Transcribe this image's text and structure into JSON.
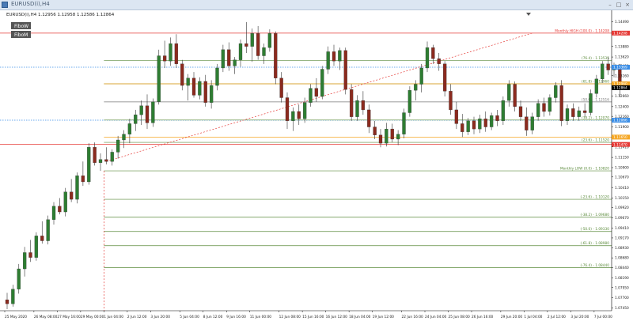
{
  "window": {
    "title": "EURUSD(i),H4",
    "minimize_glyph": "–",
    "maximize_glyph": "□",
    "close_glyph": "×"
  },
  "chart_info": "EURUSD(i),H4  1.12956 1.12958 1.12586 1.12864",
  "indicator_labels": [
    "FiboW",
    "FiboM"
  ],
  "current_price": {
    "value": 1.12864,
    "label": "1.12864",
    "color": "#000000"
  },
  "colors": {
    "bull": "#2e7d32",
    "bear": "#8b2a1e",
    "fib_green": "#5a8a3a",
    "monthly_high": "#e53935",
    "orange": "#f5a623",
    "blue_dotted": "#3b8ee6",
    "trend": "#e53935"
  },
  "price_axis_labels": [
    "1.14490",
    "1.14185",
    "1.13880",
    "1.13620",
    "1.13400",
    "1.13160",
    "1.12900",
    "1.12660",
    "1.12400",
    "1.12160",
    "1.11900",
    "1.11670",
    "1.11410",
    "1.11150",
    "1.10900",
    "1.10670",
    "1.10410",
    "1.10150",
    "1.09920",
    "1.09670",
    "1.09410",
    "1.09170",
    "1.08930",
    "1.08680",
    "1.08440",
    "1.08190",
    "1.07950",
    "1.07700",
    "1.07450"
  ],
  "price_tags": [
    {
      "price": 1.14208,
      "label": "1.14208",
      "color": "#e53935"
    },
    {
      "price": 1.13369,
      "label": "1.13369",
      "color": "#3b8ee6"
    },
    {
      "price": 1.1296,
      "label": "1.12960",
      "color": "#f5a623"
    },
    {
      "price": 1.12066,
      "label": "1.12066",
      "color": "#3b8ee6"
    },
    {
      "price": 1.1165,
      "label": "1.11650",
      "color": "#f5a623"
    },
    {
      "price": 1.1147,
      "label": "1.11470",
      "color": "#e53935"
    }
  ],
  "level_lines": [
    {
      "price": 1.14208,
      "label": "Monthly HIGH (100.0) - 1.14208",
      "color": "#e53935",
      "style": "solid",
      "label_at": "right"
    },
    {
      "price": 1.13535,
      "label": "(76.4) - 1.13535",
      "color": "#5a8a3a",
      "style": "solid",
      "label_at": "right"
    },
    {
      "price": 1.13369,
      "label": "",
      "color": "#3b8ee6",
      "style": "dotted",
      "label_at": "right"
    },
    {
      "price": 1.1296,
      "label": "(61.8) - 1.12960",
      "color": "#5a8a3a",
      "style": "solid",
      "label_at": "right"
    },
    {
      "price": 1.1296,
      "label": "",
      "color": "#f5a623",
      "style": "solid",
      "label_at": "right"
    },
    {
      "price": 1.12516,
      "label": "(50.0) - 1.12516",
      "color": "#7a7a7a",
      "style": "solid",
      "label_at": "right"
    },
    {
      "price": 1.12066,
      "label": "",
      "color": "#3b8ee6",
      "style": "dotted",
      "label_at": "right"
    },
    {
      "price": 1.1207,
      "label": "(38.2) - 1.12070",
      "color": "#5a8a3a",
      "style": "solid",
      "label_at": "right"
    },
    {
      "price": 1.1165,
      "label": "",
      "color": "#f5a623",
      "style": "solid",
      "label_at": "right"
    },
    {
      "price": 1.1152,
      "label": "(23.6) - 1.11520",
      "color": "#5a8a3a",
      "style": "solid",
      "label_at": "right"
    },
    {
      "price": 1.1147,
      "label": "",
      "color": "#e53935",
      "style": "solid",
      "label_at": "right"
    },
    {
      "price": 1.1082,
      "label": "Monthly LOW (0.0) - 1.10820",
      "color": "#5a8a3a",
      "style": "solid",
      "label_at": "right"
    },
    {
      "price": 1.1012,
      "label": "(-23.6) - 1.10120",
      "color": "#5a8a3a",
      "style": "solid",
      "label_at": "right"
    },
    {
      "price": 1.0968,
      "label": "(-38.2) - 1.09680",
      "color": "#5a8a3a",
      "style": "solid",
      "label_at": "right"
    },
    {
      "price": 1.0933,
      "label": "(-50.0) - 1.09330",
      "color": "#5a8a3a",
      "style": "solid",
      "label_at": "right"
    },
    {
      "price": 1.0898,
      "label": "(-61.8) - 1.08980",
      "color": "#5a8a3a",
      "style": "solid",
      "label_at": "right"
    },
    {
      "price": 1.0844,
      "label": "(-76.4) - 1.08440",
      "color": "#5a8a3a",
      "style": "solid",
      "label_at": "right"
    }
  ],
  "trend_line": {
    "from": {
      "bar": 17,
      "price": 1.1105
    },
    "to": {
      "bar": 90,
      "price": 1.14208
    }
  },
  "vertical_marker_bar": 17,
  "time_labels": [
    {
      "bar": 0,
      "label": "25 May 2020"
    },
    {
      "bar": 5,
      "label": "26 May 08:00"
    },
    {
      "bar": 9,
      "label": "27 May 16:00"
    },
    {
      "bar": 13,
      "label": "29 May 00:00"
    },
    {
      "bar": 17,
      "label": "1 Jun 04:00"
    },
    {
      "bar": 21,
      "label": "2 Jun 12:00"
    },
    {
      "bar": 25,
      "label": "3 Jun 20:00"
    },
    {
      "bar": 30,
      "label": "5 Jun 04:00"
    },
    {
      "bar": 34,
      "label": "8 Jun 12:00"
    },
    {
      "bar": 38,
      "label": "9 Jun 16:00"
    },
    {
      "bar": 42,
      "label": "11 Jun 00:00"
    },
    {
      "bar": 47,
      "label": "12 Jun 08:00"
    },
    {
      "bar": 51,
      "label": "15 Jun 16:00"
    },
    {
      "bar": 55,
      "label": "16 Jun 12:00"
    },
    {
      "bar": 59,
      "label": "18 Jun 04:00"
    },
    {
      "bar": 63,
      "label": "19 Jun 12:00"
    },
    {
      "bar": 68,
      "label": "22 Jun 16:00"
    },
    {
      "bar": 72,
      "label": "24 Jun 04:00"
    },
    {
      "bar": 76,
      "label": "25 Jun 08:00"
    },
    {
      "bar": 80,
      "label": "26 Jun 16:00"
    },
    {
      "bar": 85,
      "label": "29 Jun 20:00"
    },
    {
      "bar": 89,
      "label": "1 Jul 04:00"
    },
    {
      "bar": 93,
      "label": "2 Jul 12:00"
    },
    {
      "bar": 97,
      "label": "3 Jul 20:00"
    },
    {
      "bar": 101,
      "label": "7 Jul 00:00"
    }
  ],
  "chart_data": {
    "type": "candlestick",
    "symbol": "EURUSD(i)",
    "timeframe": "H4",
    "ylim": [
      1.0738,
      1.1473
    ],
    "x_range": [
      0,
      104
    ],
    "grid": false,
    "series": [
      {
        "open": 1.0765,
        "high": 1.0782,
        "low": 1.0742,
        "close": 1.0755
      },
      {
        "open": 1.0755,
        "high": 1.0802,
        "low": 1.0748,
        "close": 1.0791
      },
      {
        "open": 1.0791,
        "high": 1.0853,
        "low": 1.078,
        "close": 1.0841
      },
      {
        "open": 1.0841,
        "high": 1.0895,
        "low": 1.0822,
        "close": 1.0881
      },
      {
        "open": 1.0881,
        "high": 1.0912,
        "low": 1.0858,
        "close": 1.0869
      },
      {
        "open": 1.0869,
        "high": 1.0931,
        "low": 1.0861,
        "close": 1.0922
      },
      {
        "open": 1.0922,
        "high": 1.0958,
        "low": 1.0903,
        "close": 1.091
      },
      {
        "open": 1.091,
        "high": 1.0972,
        "low": 1.0901,
        "close": 1.0962
      },
      {
        "open": 1.0962,
        "high": 1.1005,
        "low": 1.095,
        "close": 1.0995
      },
      {
        "open": 1.0995,
        "high": 1.1015,
        "low": 1.0975,
        "close": 1.0981
      },
      {
        "open": 1.0981,
        "high": 1.104,
        "low": 1.097,
        "close": 1.103
      },
      {
        "open": 1.103,
        "high": 1.1062,
        "low": 1.1005,
        "close": 1.1012
      },
      {
        "open": 1.1012,
        "high": 1.1078,
        "low": 1.1002,
        "close": 1.107
      },
      {
        "open": 1.107,
        "high": 1.1105,
        "low": 1.1045,
        "close": 1.1055
      },
      {
        "open": 1.1055,
        "high": 1.115,
        "low": 1.1048,
        "close": 1.114
      },
      {
        "open": 1.114,
        "high": 1.1152,
        "low": 1.1095,
        "close": 1.1102
      },
      {
        "open": 1.1102,
        "high": 1.1125,
        "low": 1.1082,
        "close": 1.111
      },
      {
        "open": 1.111,
        "high": 1.114,
        "low": 1.1098,
        "close": 1.1105
      },
      {
        "open": 1.1105,
        "high": 1.1135,
        "low": 1.1095,
        "close": 1.1128
      },
      {
        "open": 1.1128,
        "high": 1.1168,
        "low": 1.1112,
        "close": 1.1158
      },
      {
        "open": 1.1158,
        "high": 1.1182,
        "low": 1.1138,
        "close": 1.1172
      },
      {
        "open": 1.1172,
        "high": 1.121,
        "low": 1.115,
        "close": 1.1198
      },
      {
        "open": 1.1198,
        "high": 1.1232,
        "low": 1.118,
        "close": 1.122
      },
      {
        "open": 1.122,
        "high": 1.1255,
        "low": 1.1195,
        "close": 1.1242
      },
      {
        "open": 1.1242,
        "high": 1.127,
        "low": 1.1185,
        "close": 1.12
      },
      {
        "open": 1.12,
        "high": 1.126,
        "low": 1.119,
        "close": 1.1252
      },
      {
        "open": 1.1252,
        "high": 1.138,
        "low": 1.1245,
        "close": 1.1365
      },
      {
        "open": 1.1365,
        "high": 1.1402,
        "low": 1.1335,
        "close": 1.1352
      },
      {
        "open": 1.1352,
        "high": 1.141,
        "low": 1.134,
        "close": 1.1395
      },
      {
        "open": 1.1395,
        "high": 1.1418,
        "low": 1.1335,
        "close": 1.1345
      },
      {
        "open": 1.1345,
        "high": 1.1355,
        "low": 1.128,
        "close": 1.1292
      },
      {
        "open": 1.1292,
        "high": 1.132,
        "low": 1.1255,
        "close": 1.131
      },
      {
        "open": 1.131,
        "high": 1.1325,
        "low": 1.1262,
        "close": 1.1268
      },
      {
        "open": 1.1268,
        "high": 1.1312,
        "low": 1.1258,
        "close": 1.1302
      },
      {
        "open": 1.1302,
        "high": 1.1318,
        "low": 1.124,
        "close": 1.125
      },
      {
        "open": 1.125,
        "high": 1.1305,
        "low": 1.1235,
        "close": 1.1292
      },
      {
        "open": 1.1292,
        "high": 1.1345,
        "low": 1.128,
        "close": 1.1335
      },
      {
        "open": 1.1335,
        "high": 1.1392,
        "low": 1.1325,
        "close": 1.138
      },
      {
        "open": 1.138,
        "high": 1.1398,
        "low": 1.1328,
        "close": 1.134
      },
      {
        "open": 1.134,
        "high": 1.1362,
        "low": 1.132,
        "close": 1.1355
      },
      {
        "open": 1.1355,
        "high": 1.1405,
        "low": 1.1338,
        "close": 1.1395
      },
      {
        "open": 1.1395,
        "high": 1.1448,
        "low": 1.1372,
        "close": 1.1388
      },
      {
        "open": 1.1388,
        "high": 1.1432,
        "low": 1.135,
        "close": 1.142
      },
      {
        "open": 1.142,
        "high": 1.1438,
        "low": 1.1355,
        "close": 1.1365
      },
      {
        "open": 1.1365,
        "high": 1.1395,
        "low": 1.1345,
        "close": 1.1385
      },
      {
        "open": 1.1385,
        "high": 1.143,
        "low": 1.1375,
        "close": 1.142
      },
      {
        "open": 1.142,
        "high": 1.1425,
        "low": 1.1295,
        "close": 1.131
      },
      {
        "open": 1.131,
        "high": 1.1325,
        "low": 1.125,
        "close": 1.1262
      },
      {
        "open": 1.1262,
        "high": 1.1275,
        "low": 1.1185,
        "close": 1.1205
      },
      {
        "open": 1.1205,
        "high": 1.1238,
        "low": 1.118,
        "close": 1.1228
      },
      {
        "open": 1.1228,
        "high": 1.1245,
        "low": 1.1195,
        "close": 1.121
      },
      {
        "open": 1.121,
        "high": 1.1262,
        "low": 1.12,
        "close": 1.125
      },
      {
        "open": 1.125,
        "high": 1.1295,
        "low": 1.124,
        "close": 1.1285
      },
      {
        "open": 1.1285,
        "high": 1.131,
        "low": 1.1252,
        "close": 1.1265
      },
      {
        "open": 1.1265,
        "high": 1.134,
        "low": 1.1258,
        "close": 1.1332
      },
      {
        "open": 1.1332,
        "high": 1.1388,
        "low": 1.132,
        "close": 1.1375
      },
      {
        "open": 1.1375,
        "high": 1.1392,
        "low": 1.134,
        "close": 1.1352
      },
      {
        "open": 1.1352,
        "high": 1.1385,
        "low": 1.133,
        "close": 1.1378
      },
      {
        "open": 1.1378,
        "high": 1.1385,
        "low": 1.127,
        "close": 1.1282
      },
      {
        "open": 1.1282,
        "high": 1.1295,
        "low": 1.1205,
        "close": 1.1215
      },
      {
        "open": 1.1215,
        "high": 1.1268,
        "low": 1.1205,
        "close": 1.1255
      },
      {
        "open": 1.1255,
        "high": 1.1278,
        "low": 1.122,
        "close": 1.1232
      },
      {
        "open": 1.1232,
        "high": 1.1245,
        "low": 1.1175,
        "close": 1.119
      },
      {
        "open": 1.119,
        "high": 1.1205,
        "low": 1.116,
        "close": 1.117
      },
      {
        "open": 1.117,
        "high": 1.1185,
        "low": 1.114,
        "close": 1.115
      },
      {
        "open": 1.115,
        "high": 1.12,
        "low": 1.1142,
        "close": 1.1185
      },
      {
        "open": 1.1185,
        "high": 1.1198,
        "low": 1.1152,
        "close": 1.116
      },
      {
        "open": 1.116,
        "high": 1.1182,
        "low": 1.1145,
        "close": 1.1172
      },
      {
        "open": 1.1172,
        "high": 1.1235,
        "low": 1.1162,
        "close": 1.1225
      },
      {
        "open": 1.1225,
        "high": 1.129,
        "low": 1.1215,
        "close": 1.128
      },
      {
        "open": 1.128,
        "high": 1.1305,
        "low": 1.1255,
        "close": 1.1295
      },
      {
        "open": 1.1295,
        "high": 1.1345,
        "low": 1.1275,
        "close": 1.1335
      },
      {
        "open": 1.1335,
        "high": 1.14,
        "low": 1.1325,
        "close": 1.1385
      },
      {
        "open": 1.1385,
        "high": 1.1392,
        "low": 1.1345,
        "close": 1.1358
      },
      {
        "open": 1.1358,
        "high": 1.1372,
        "low": 1.1328,
        "close": 1.1345
      },
      {
        "open": 1.1345,
        "high": 1.1352,
        "low": 1.1265,
        "close": 1.1278
      },
      {
        "open": 1.1278,
        "high": 1.1295,
        "low": 1.122,
        "close": 1.1232
      },
      {
        "open": 1.1232,
        "high": 1.1252,
        "low": 1.1185,
        "close": 1.1198
      },
      {
        "open": 1.1198,
        "high": 1.1222,
        "low": 1.1165,
        "close": 1.1178
      },
      {
        "open": 1.1178,
        "high": 1.1212,
        "low": 1.117,
        "close": 1.1205
      },
      {
        "open": 1.1205,
        "high": 1.1215,
        "low": 1.1172,
        "close": 1.1185
      },
      {
        "open": 1.1185,
        "high": 1.122,
        "low": 1.1175,
        "close": 1.121
      },
      {
        "open": 1.121,
        "high": 1.1228,
        "low": 1.1178,
        "close": 1.119
      },
      {
        "open": 1.119,
        "high": 1.1225,
        "low": 1.1182,
        "close": 1.1218
      },
      {
        "open": 1.1218,
        "high": 1.1232,
        "low": 1.1192,
        "close": 1.1205
      },
      {
        "open": 1.1205,
        "high": 1.1265,
        "low": 1.1195,
        "close": 1.1255
      },
      {
        "open": 1.1255,
        "high": 1.1305,
        "low": 1.124,
        "close": 1.1295
      },
      {
        "open": 1.1295,
        "high": 1.1302,
        "low": 1.1228,
        "close": 1.124
      },
      {
        "open": 1.124,
        "high": 1.1255,
        "low": 1.1205,
        "close": 1.1215
      },
      {
        "open": 1.1215,
        "high": 1.1238,
        "low": 1.1168,
        "close": 1.1182
      },
      {
        "open": 1.1182,
        "high": 1.1225,
        "low": 1.1172,
        "close": 1.1215
      },
      {
        "open": 1.1215,
        "high": 1.1258,
        "low": 1.1205,
        "close": 1.1248
      },
      {
        "open": 1.1248,
        "high": 1.1262,
        "low": 1.1215,
        "close": 1.1228
      },
      {
        "open": 1.1228,
        "high": 1.127,
        "low": 1.1218,
        "close": 1.1262
      },
      {
        "open": 1.1262,
        "high": 1.13,
        "low": 1.125,
        "close": 1.1292
      },
      {
        "open": 1.1292,
        "high": 1.1305,
        "low": 1.1192,
        "close": 1.1205
      },
      {
        "open": 1.1205,
        "high": 1.1245,
        "low": 1.1195,
        "close": 1.1235
      },
      {
        "open": 1.1235,
        "high": 1.1248,
        "low": 1.1205,
        "close": 1.1215
      },
      {
        "open": 1.1215,
        "high": 1.124,
        "low": 1.1205,
        "close": 1.123
      },
      {
        "open": 1.123,
        "high": 1.1248,
        "low": 1.1215,
        "close": 1.1225
      },
      {
        "open": 1.1225,
        "high": 1.1282,
        "low": 1.1218,
        "close": 1.1272
      },
      {
        "open": 1.1272,
        "high": 1.1318,
        "low": 1.1262,
        "close": 1.1308
      },
      {
        "open": 1.1308,
        "high": 1.1352,
        "low": 1.1298,
        "close": 1.1345
      },
      {
        "open": 1.1345,
        "high": 1.1362,
        "low": 1.1318,
        "close": 1.133
      },
      {
        "open": 1.133,
        "high": 1.1348,
        "low": 1.1312,
        "close": 1.134
      },
      {
        "open": 1.134,
        "high": 1.1345,
        "low": 1.1265,
        "close": 1.1286
      }
    ]
  }
}
